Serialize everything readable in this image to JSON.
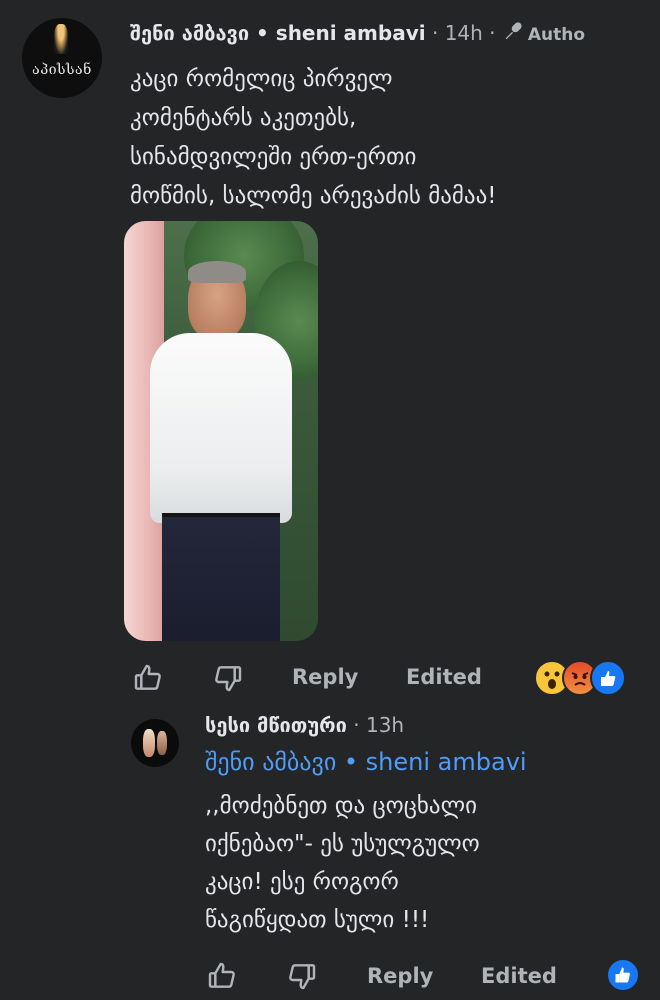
{
  "comment1": {
    "avatar_logo": "აპისსან",
    "author": "შენი ამბავი • sheni ambavi",
    "separator1": " · ",
    "time": "14h",
    "separator2": " · ",
    "badge": "Autho",
    "text_lines": [
      "კაცი რომელიც პირველ",
      "კომენტარს აკეთებს,",
      "სინამდვილეში ერთ-ერთი",
      "მოწმის, სალომე არევაძის მამაა!"
    ],
    "actions": {
      "reply": "Reply",
      "edited": "Edited"
    },
    "reactions": [
      "wow",
      "angry",
      "like"
    ]
  },
  "comment2": {
    "author": "სესი მწითური",
    "separator": " · ",
    "time": "13h",
    "mention": "შენი ამბავი • sheni ambavi",
    "text_lines": [
      ",,მოძებნეთ და ცოცხალი",
      "იქნებაო\"- ეს უსულგულო",
      "კაცი! ესე როგორ",
      "წაგიწყდათ სული !!!"
    ],
    "actions": {
      "reply": "Reply",
      "edited": "Edited"
    },
    "reactions": [
      "like"
    ]
  },
  "colors": {
    "background": "#242526",
    "text": "#e4e6eb",
    "muted": "#b0b3b8",
    "mention": "#4f9cf9",
    "like_blue": "#1877f2"
  }
}
